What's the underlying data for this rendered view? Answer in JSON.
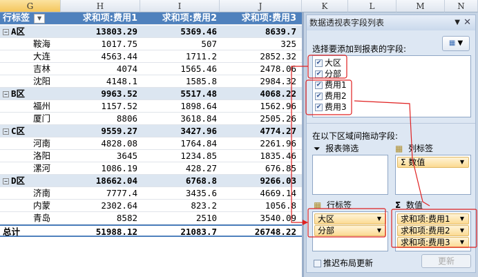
{
  "columns": [
    "G",
    "H",
    "I",
    "J",
    "K",
    "L",
    "M",
    "N"
  ],
  "pivot": {
    "header": {
      "row_label": "行标签",
      "c1": "求和项:费用1",
      "c2": "求和项:费用2",
      "c3": "求和项:费用3"
    },
    "groups": [
      {
        "name": "A区",
        "v": [
          "13803.29",
          "5369.46",
          "8639.7"
        ],
        "items": [
          [
            "鞍海",
            "1017.75",
            "507",
            "325"
          ],
          [
            "大连",
            "4563.44",
            "1711.2",
            "2852.32"
          ],
          [
            "吉林",
            "4074",
            "1565.46",
            "2478.06"
          ],
          [
            "沈阳",
            "4148.1",
            "1585.8",
            "2984.32"
          ]
        ]
      },
      {
        "name": "B区",
        "v": [
          "9963.52",
          "5517.48",
          "4068.22"
        ],
        "items": [
          [
            "福州",
            "1157.52",
            "1898.64",
            "1562.96"
          ],
          [
            "厦门",
            "8806",
            "3618.84",
            "2505.26"
          ]
        ]
      },
      {
        "name": "C区",
        "v": [
          "9559.27",
          "3427.96",
          "4774.27"
        ],
        "items": [
          [
            "河南",
            "4828.08",
            "1764.84",
            "2261.96"
          ],
          [
            "洛阳",
            "3645",
            "1234.85",
            "1835.46"
          ],
          [
            "漯河",
            "1086.19",
            "428.27",
            "676.85"
          ]
        ]
      },
      {
        "name": "D区",
        "v": [
          "18662.04",
          "6768.8",
          "9266.03"
        ],
        "items": [
          [
            "济南",
            "7777.4",
            "3435.6",
            "4669.14"
          ],
          [
            "内蒙",
            "2302.64",
            "823.2",
            "1056.8"
          ],
          [
            "青岛",
            "8582",
            "2510",
            "3540.09"
          ]
        ]
      }
    ],
    "total": {
      "label": "总计",
      "v": [
        "51988.12",
        "21083.7",
        "26748.22"
      ]
    }
  },
  "panel": {
    "title": "数据透视表字段列表",
    "choose_label": "选择要添加到报表的字段:",
    "fields": [
      "大区",
      "分部",
      "费用1",
      "费用2",
      "费用3"
    ],
    "drag_label": "在以下区域间拖动字段:",
    "filter_label": "报表筛选",
    "col_label": "列标签",
    "row_label": "行标签",
    "values_label": "数值",
    "col_items": [
      "Σ 数值"
    ],
    "row_items": [
      "大区",
      "分部"
    ],
    "value_items": [
      "求和项:费用1",
      "求和项:费用2",
      "求和项:费用3"
    ],
    "defer_label": "推迟布局更新",
    "update_label": "更新"
  },
  "colors": {
    "header": "#4f81bd",
    "group": "#dce6f1",
    "annotation": "#e02020"
  }
}
